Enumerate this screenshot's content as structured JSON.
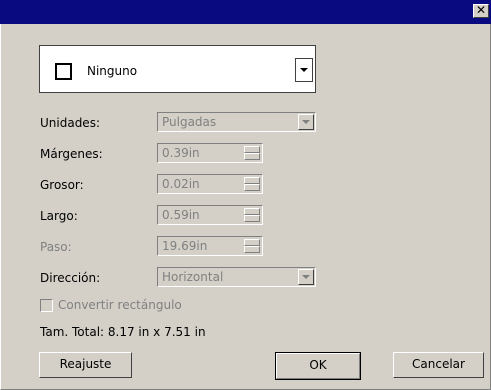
{
  "window": {
    "close_glyph": "✕"
  },
  "style_combo": {
    "value": "Ninguno",
    "icon": "empty-square-swatch"
  },
  "fields": {
    "units": {
      "label": "Unidades:",
      "value": "Pulgadas"
    },
    "margins": {
      "label": "Márgenes:",
      "value": "0.39in"
    },
    "thickness": {
      "label": "Grosor:",
      "value": "0.02in"
    },
    "length": {
      "label": "Largo:",
      "value": "0.59in"
    },
    "step": {
      "label": "Paso:",
      "value": "19.69in"
    },
    "direction": {
      "label": "Dirección:",
      "value": "Horizontal"
    }
  },
  "convert_checkbox": {
    "label": "Convertir rectángulo",
    "checked": false,
    "enabled": false
  },
  "total_size": "Tam. Total: 8.17 in x 7.51 in",
  "buttons": {
    "reset": "Reajuste",
    "ok": "OK",
    "cancel": "Cancelar"
  }
}
